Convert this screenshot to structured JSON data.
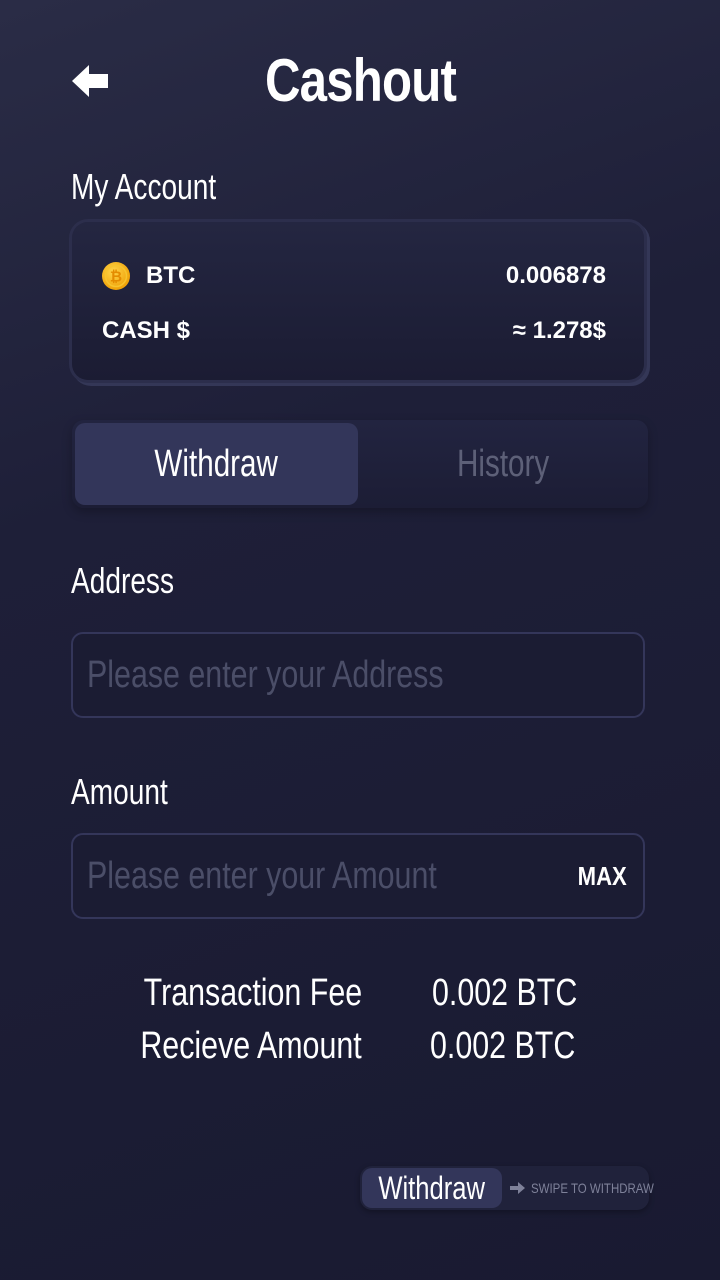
{
  "header": {
    "title": "Cashout",
    "back_icon": "arrow-left-icon"
  },
  "account": {
    "label": "My Account",
    "btc": {
      "icon": "bitcoin-coin-icon",
      "label": "BTC",
      "value": "0.006878"
    },
    "cash": {
      "label": "CASH $",
      "value": "≈ 1.278$"
    }
  },
  "tabs": [
    {
      "label": "Withdraw",
      "active": true
    },
    {
      "label": "History",
      "active": false
    }
  ],
  "address": {
    "label": "Address",
    "placeholder": "Please enter your Address",
    "value": ""
  },
  "amount": {
    "label": "Amount",
    "placeholder": "Please enter your Amount",
    "value": "",
    "max_label": "MAX"
  },
  "fees": {
    "transaction_fee_label": "Transaction Fee",
    "transaction_fee_value": "0.002 BTC",
    "receive_label": "Recieve Amount",
    "receive_value": "0.002 BTC"
  },
  "swipe": {
    "button_label": "Withdraw",
    "hint": "SWIPE TO WITHDRAW",
    "hint_icon": "arrow-right-icon"
  },
  "colors": {
    "background": "#1e1f38",
    "accent": "#33365a",
    "coin": "#f0a30a",
    "muted": "#5d6078"
  }
}
